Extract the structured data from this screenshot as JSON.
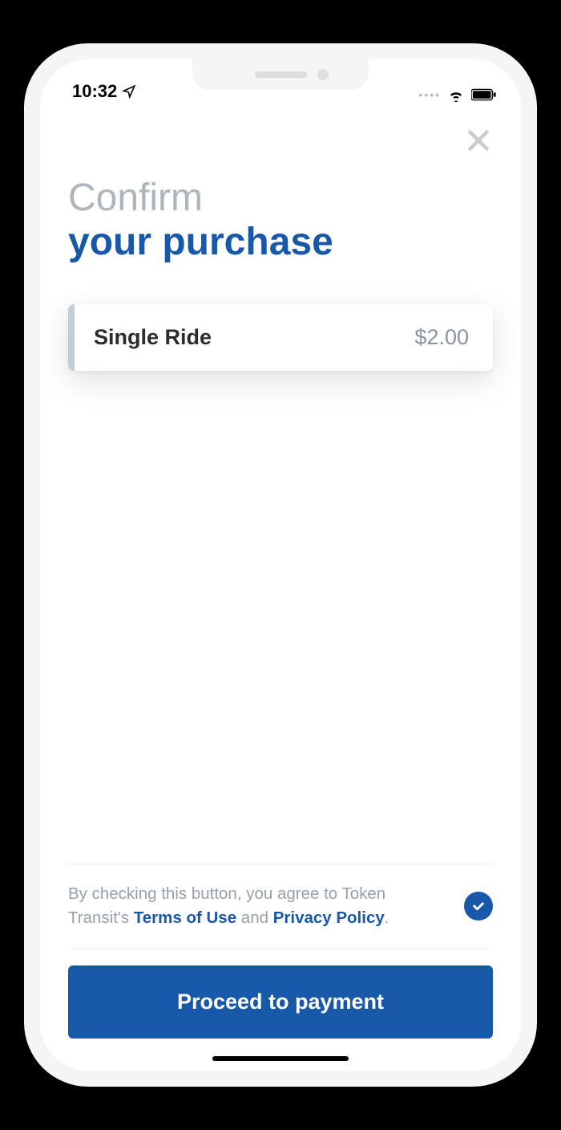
{
  "status": {
    "time": "10:32"
  },
  "heading": {
    "line1": "Confirm",
    "line2": "your purchase"
  },
  "item": {
    "name": "Single Ride",
    "price": "$2.00"
  },
  "terms": {
    "prefix": "By checking this button, you agree to Token Transit's ",
    "terms_label": "Terms of Use",
    "and": " and ",
    "privacy_label": "Privacy Policy",
    "suffix": "."
  },
  "cta": {
    "label": "Proceed to payment"
  }
}
